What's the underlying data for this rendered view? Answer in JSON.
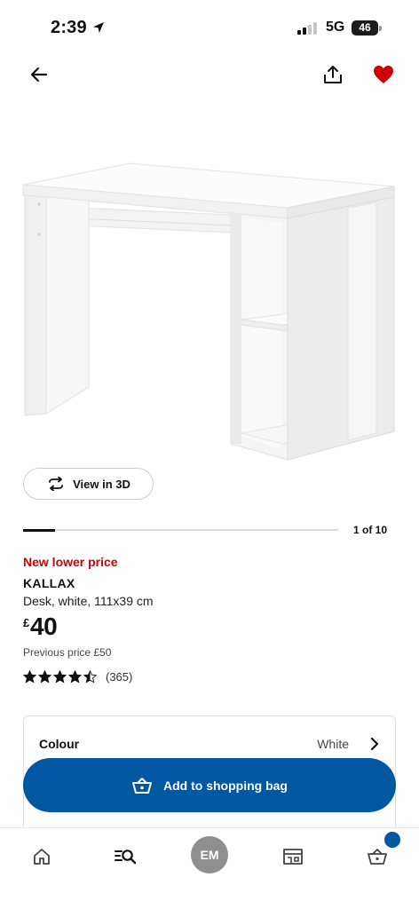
{
  "status_bar": {
    "time": "2:39",
    "network": "5G",
    "battery": "46"
  },
  "product": {
    "price_flag": "New lower price",
    "name": "KALLAX",
    "description": "Desk, white, 111x39 cm",
    "currency_symbol": "£",
    "price": "40",
    "previous_price": "Previous price £50",
    "rating": 4.5,
    "review_count": "(365)"
  },
  "gallery": {
    "view_3d_label": "View in 3D",
    "counter": "1 of 10",
    "progress": 0.1
  },
  "colour": {
    "label": "Colour",
    "value": "White"
  },
  "cart": {
    "add_label": "Add to shopping bag"
  },
  "nav": {
    "profile_initials": "EM"
  },
  "colors": {
    "accent_blue": "#0058a3",
    "sale_red": "#cc0008",
    "favorite_red": "#cc0008",
    "avatar_grey": "#8f8f8f"
  },
  "icons": [
    "location-arrow-icon",
    "signal-icon",
    "battery-icon",
    "back-arrow-icon",
    "share-icon",
    "heart-icon",
    "rotate-3d-icon",
    "star-icon",
    "chevron-right-icon",
    "basket-icon",
    "home-icon",
    "search-list-icon",
    "store-icon",
    "bag-icon"
  ]
}
